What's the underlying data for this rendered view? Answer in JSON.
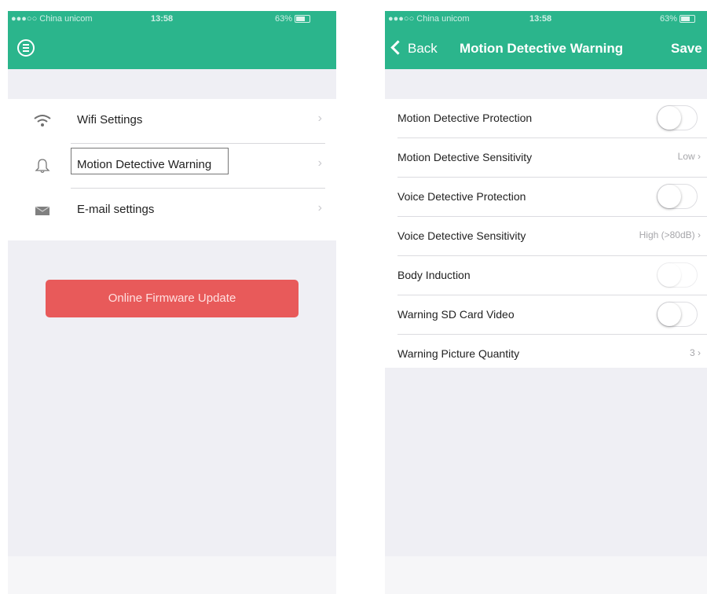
{
  "left_screen": {
    "status": {
      "carrier": "●●●○○ China unicom",
      "time": "13:58",
      "battery": "63%"
    },
    "menu_items": [
      {
        "icon": "wifi-icon",
        "label": "Wifi Settings"
      },
      {
        "icon": "bell-icon",
        "label": "Motion Detective Warning"
      },
      {
        "icon": "mail-icon",
        "label": "E-mail settings"
      }
    ],
    "firmware_button": "Online Firmware Update"
  },
  "right_screen": {
    "status": {
      "carrier": "●●●○○ China unicom",
      "time": "13:58",
      "battery": "63%"
    },
    "nav": {
      "back": "Back",
      "title": "Motion Detective Warning",
      "save": "Save"
    },
    "settings": [
      {
        "label": "Motion Detective Protection",
        "type": "toggle",
        "on": false
      },
      {
        "label": "Motion Detective Sensitivity",
        "type": "select",
        "value": "Low"
      },
      {
        "label": "Voice Detective Protection",
        "type": "toggle",
        "on": false
      },
      {
        "label": "Voice Detective Sensitivity",
        "type": "select",
        "value": "High (>80dB)"
      },
      {
        "label": "Body Induction",
        "type": "toggle",
        "on": false
      },
      {
        "label": "Warning SD Card Video",
        "type": "toggle",
        "on": false
      },
      {
        "label": "Warning Picture Quantity",
        "type": "select",
        "value": "3"
      }
    ]
  },
  "colors": {
    "header": "#2bb58c",
    "firmware_button": "#e85a5a",
    "background": "#efeff4"
  }
}
